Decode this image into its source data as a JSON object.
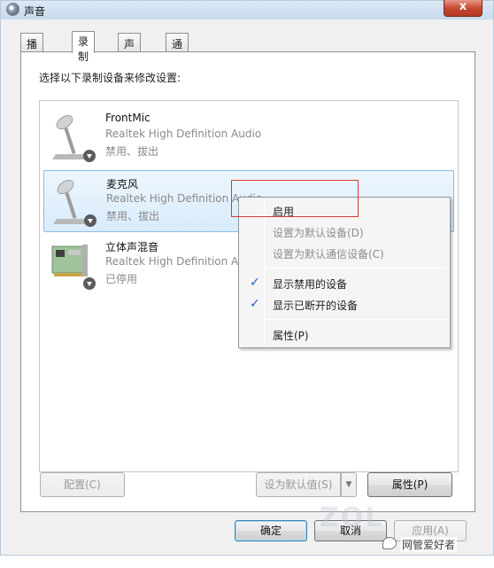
{
  "window": {
    "title": "声音",
    "close_label": "x",
    "icon": "speaker-gear-icon"
  },
  "tabs": [
    {
      "label": "播放",
      "active": false
    },
    {
      "label": "录制",
      "active": true
    },
    {
      "label": "声音",
      "active": false
    },
    {
      "label": "通信",
      "active": false
    }
  ],
  "instruction": "选择以下录制设备来修改设置:",
  "devices": [
    {
      "name": "FrontMic",
      "driver": "Realtek High Definition Audio",
      "status": "禁用、拔出",
      "icon": "microphone-icon",
      "selected": false
    },
    {
      "name": "麦克风",
      "driver": "Realtek High Definition Audio",
      "status": "禁用、拔出",
      "icon": "microphone-icon",
      "selected": true
    },
    {
      "name": "立体声混音",
      "driver": "Realtek High Definition Audio",
      "status": "已停用",
      "icon": "sound-card-icon",
      "selected": false
    }
  ],
  "context_menu": {
    "items": [
      {
        "label": "启用",
        "disabled": false,
        "checked": false
      },
      {
        "label": "设置为默认设备(D)",
        "disabled": true,
        "checked": false
      },
      {
        "label": "设置为默认通信设备(C)",
        "disabled": true,
        "checked": false
      },
      {
        "label": "显示禁用的设备",
        "disabled": false,
        "checked": true
      },
      {
        "label": "显示已断开的设备",
        "disabled": false,
        "checked": true
      },
      {
        "label": "属性(P)",
        "disabled": false,
        "checked": false
      }
    ],
    "check_glyph": "✓"
  },
  "buttons": {
    "configure": "配置(C)",
    "set_default": "设为默认值(S)",
    "properties": "属性(P)",
    "ok": "确定",
    "cancel": "取消",
    "apply": "应用(A)"
  },
  "watermark": {
    "text": "网管爱好者",
    "zol": "ZOL"
  },
  "colors": {
    "highlight_border": "#d43a3a",
    "selection_bg": "#d8ebfb",
    "check": "#1c5fb8"
  }
}
